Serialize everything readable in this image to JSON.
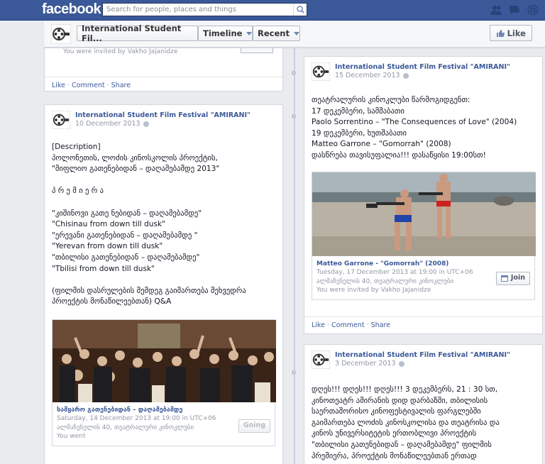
{
  "top": {
    "logo": "facebook",
    "search_placeholder": "Search for people, places and things"
  },
  "nav": {
    "page_title": "International Student Fil...",
    "timeline_label": "Timeline",
    "recent_label": "Recent",
    "like_label": "Like"
  },
  "left_top": {
    "invited": "You were invited by Vakho Jajanidze",
    "like": "Like",
    "comment": "Comment",
    "share": "Share"
  },
  "post_left": {
    "page_name": "International Student Film Festival \"AMIRANI\"",
    "date": "10 December 2013",
    "text": "[Description]\nპოლონეთის, ლოძის კინოსკოლის პროექტის,\n\"მიფლიო გათენებიდან – დაღამებამდე 2013\"\n\nპ რ ე მ ი ე რ ა\n\n\"კიშინოვი გათე ნებიდან – დაღამებამდე\"\n\"Chisinau from down till dusk\"\n\"ერევანი გათენებიდან – დაღამებამდე \"\n\"Yerevan from down till dusk\"\n\"თბილისი გათენებიდან – დაღამებამდე\"\n\"Tbilisi from down till dusk\"\n\n(ფილმის დასრულების შემდეგ გაიმართება შეხვედრა\nპროექტის მონაწილეებთან) Q&A",
    "event_title": "სამყარო გათენებიდან – დაღამებამდე",
    "event_time": "Saturday, 14 December 2013 at 19:00 in UTC+06",
    "event_place": "ალმაჩენელის 40, თეატრალური კინოკლუბი",
    "event_status": "You went",
    "button": "Going"
  },
  "post_right1": {
    "page_name": "International Student Film Festival \"AMIRANI\"",
    "date": "15 December 2013",
    "text": "თეატრალურის კინოკლუბი წარმოგიდგენთ:\n17 დეკემბერი, სამშაბათი\nPaolo Sorrentino – \"The Consequences of Love\" (2004)\n19 დეკემბერი, ხუთშაბათი\nMatteo Garrone – \"Gomorrah\" (2008)\nდასწრება თავისუფალია!!! დასაწყისი 19:00სთ!",
    "event_title": "Matteo Garrone - \"Gomorrah\" (2008)",
    "event_time": "Tuesday, 17 December 2013 at 19:00 in UTC+06",
    "event_place": "ალმაჩენელის 40, თეატრალური კინოკლუბი",
    "event_status": "You were invited by Vakho Jajanidze",
    "button": "Join",
    "like": "Like",
    "comment": "Comment",
    "share": "Share"
  },
  "post_right2": {
    "page_name": "International Student Film Festival \"AMIRANI\"",
    "date": "3 December 2013",
    "text": "დღეს!!! დღეს!!! დღეს!!! 3 დეკემბერს, 21 : 30 სთ,\nკინოთეატრ ამირანის დიდ დარბაზში, თბილისის\nსაერთაშორისო კინოფესტივალის ფარგლებში\nგაიმართება ლოძის კინოსკოლისა და თეატრისა და\nკინოს უნივერსიტეტის ერთობლივი პროექტის\n\"თბილისი გათენებიდან – დაღამებამდე\" ფილმის\nპრემიერა, პროექტის მონაწილეებთან ერთად"
  },
  "colors": {
    "brand": "#3b5998",
    "background": "#e9ebee"
  }
}
